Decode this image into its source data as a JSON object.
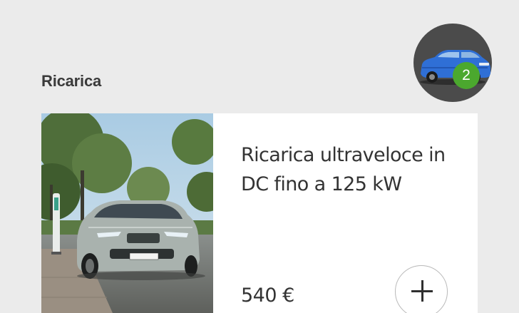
{
  "section": {
    "title": "Ricarica"
  },
  "cart": {
    "icon": "car-thumbnail-icon",
    "badge_count": "2",
    "badge_color": "#4ba82e"
  },
  "product_card": {
    "title": "Ricarica ultraveloce in DC fino a 125 kW",
    "price": "540 €",
    "image_icon": "car-charging-photo",
    "add_icon": "plus-icon"
  },
  "colors": {
    "background": "#ebebeb",
    "card": "#ffffff",
    "text": "#333333"
  }
}
